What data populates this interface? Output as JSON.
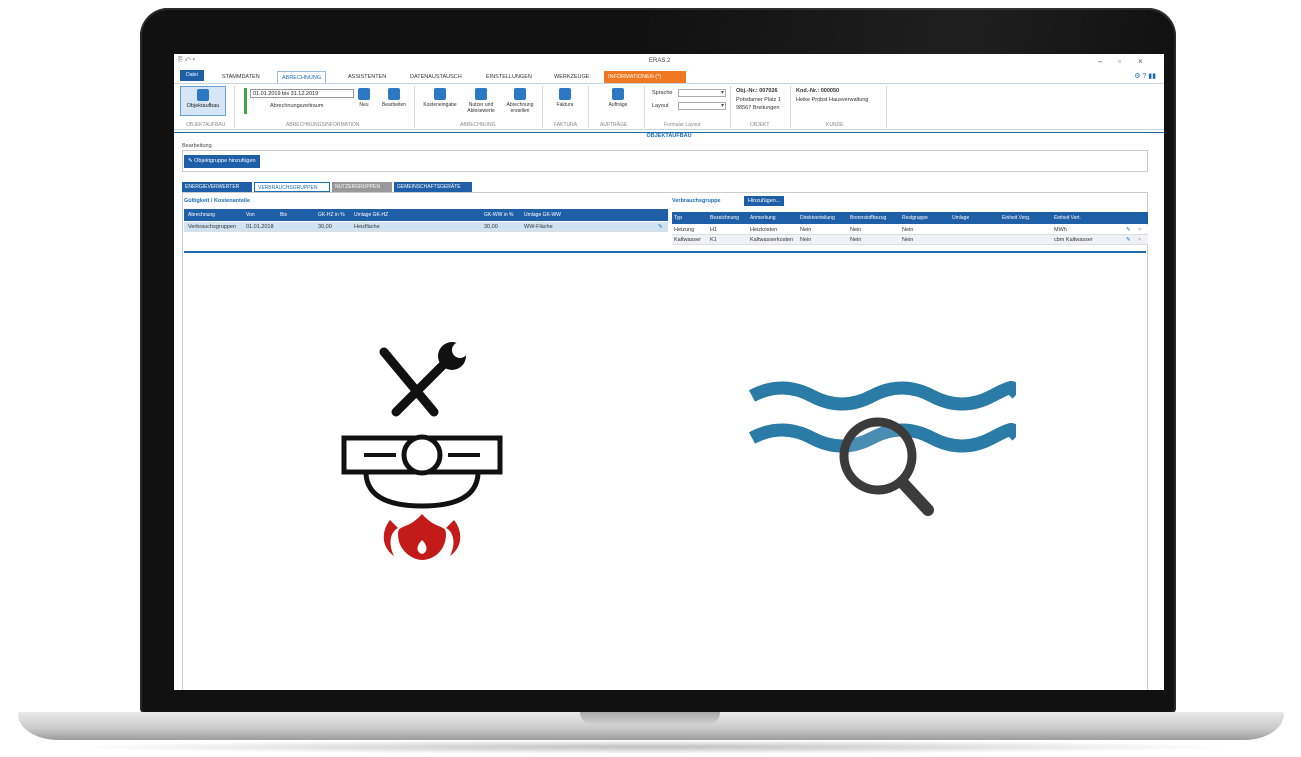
{
  "app": {
    "title": "ERAS 2",
    "datei": "Datei"
  },
  "tabs": [
    "STAMMDATEN",
    "ABRECHNUNG",
    "ASSISTENTEN",
    "DATENAUSTAUSCH",
    "EINSTELLUNGEN",
    "WERKZEUGE",
    "INFORMATIONEN (*)"
  ],
  "ribbon": {
    "objektaufbau": "Objektaufbau",
    "period_value": "01.01.2019 bis 31.12.2019",
    "period_label": "Abrechnungszeitraum",
    "neu": "Neu",
    "bearbeiten": "Bearbeiten",
    "kosteneingabe": "Kosteneingabe",
    "nutzer": "Nutzer und Ablesewerte",
    "abrechnung_erstellen": "Abrechnung erstellen",
    "faktura": "Faktura",
    "auftraege": "Aufträge",
    "sprache": "Sprache",
    "layout": "Layout",
    "obj_nr": "Obj.-Nr.: 007026",
    "obj_addr1": "Potsdamer Platz 1",
    "obj_addr2": "98567 Breitungen",
    "knd_nr": "Knd.-Nr.: 000050",
    "knd_name": "Heike Probst Hausverwaltung",
    "groups": [
      "OBJEKTAUFBAU",
      "ABRECHNUNGSINFORMATION",
      "ABRECHNUNG",
      "FAKTURA",
      "AUFTRÄGE",
      "Formular Layout",
      "OBJEKT",
      "KUNDE"
    ]
  },
  "section_title": "OBJEKTAUFBAU",
  "bearbeitung": {
    "label": "Bearbeitung",
    "add_button": "Objektgruppe hinzufügen"
  },
  "subtabs": [
    "ENERGIEVERWERTER",
    "VERBRAUCHSGRUPPEN",
    "NUTZERGRUPPEN",
    "GEMEINSCHAFTSGERÄTE"
  ],
  "left_grid": {
    "title": "Gültigkeit / Kostenanteile",
    "headers": [
      "Abrechnung",
      "Von",
      "Bis",
      "GK-HZ in %",
      "Umlage GK-HZ",
      "GK-WW in %",
      "Umlage GK-WW"
    ],
    "rows": [
      [
        "Verbrauchsgruppen",
        "01.01.2018",
        "",
        "30,00",
        "Heizfläche",
        "30,00",
        "WW-Fläche"
      ]
    ]
  },
  "right_grid": {
    "title": "Verbrauchsgruppe",
    "add_button": "Hinzufügen...",
    "headers": [
      "Typ",
      "Bezeichnung",
      "Anmerkung",
      "Direktverteilung",
      "Brennstoffbezug",
      "Restgruppe",
      "Umlage",
      "Einheit Verg.",
      "Einheit Vert."
    ],
    "rows": [
      [
        "Heizung",
        "H1",
        "Heizkosten",
        "Nein",
        "Nein",
        "Nein",
        "",
        "",
        "MWh"
      ],
      [
        "Kaltwasser",
        "K1",
        "Kaltwasserkosten",
        "Nein",
        "Nein",
        "Nein",
        "",
        "",
        "cbm Kaltwasser"
      ]
    ]
  },
  "colors": {
    "blue": "#1f5fa8",
    "orange": "#f07822",
    "flame": "#c31a1a",
    "water": "#2a7ba5",
    "green": "#3da743"
  }
}
